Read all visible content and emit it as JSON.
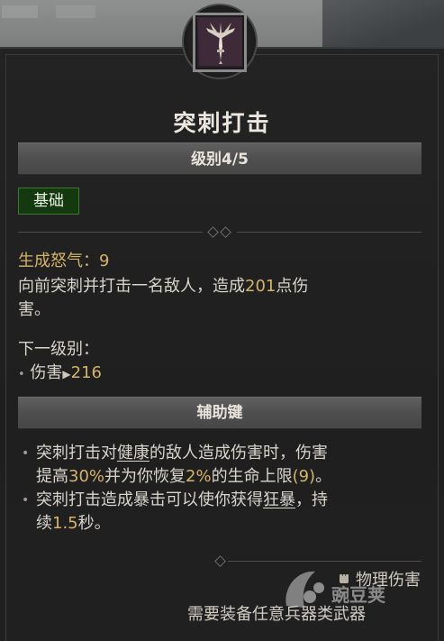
{
  "skill": {
    "name": "突刺打击",
    "level_label": "级别4/5",
    "category_badge": "基础",
    "fury_gen_label": "生成怒气：",
    "fury_gen_value": "9",
    "desc_prefix": "向前突刺并打击一名敌人，造成",
    "desc_damage": "201",
    "desc_suffix_a": "点伤",
    "desc_suffix_b": "害。",
    "next_level_label": "下一级别：",
    "next_damage_label": "伤害",
    "next_damage_value": "216"
  },
  "modifier": {
    "header": "辅助键",
    "line1_a": "突刺打击对",
    "line1_keyword": "健康",
    "line1_b": "的敌人造成伤害时，伤害",
    "line2_a": "提高",
    "line2_pct": "30%",
    "line2_b": "并为你恢复",
    "line2_heal": "2%",
    "line2_c": "的生命上限",
    "line2_paren": "(9)",
    "line2_end": "。",
    "line3_a": "突刺打击造成暴击可以使你获得",
    "line3_keyword": "狂暴",
    "line3_b": "，持",
    "line4_a": "续",
    "line4_dur": "1.5",
    "line4_b": "秒。"
  },
  "footer": {
    "damage_type": "物理伤害",
    "requirement": "需要装备任意兵器类武器",
    "watermark": "豌豆荚"
  },
  "colors": {
    "highlight": "#d4b36b",
    "text": "#d8d4cc",
    "badge_bg": "#14380f",
    "badge_border": "#3b7a2e"
  },
  "icons": [
    "sword-skill-icon",
    "fist-icon",
    "bullet-dot",
    "next-arrow"
  ]
}
